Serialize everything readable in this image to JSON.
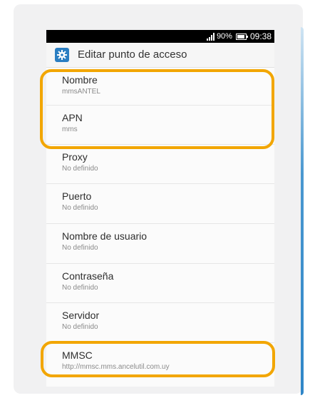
{
  "status_bar": {
    "battery_percent": "90%",
    "time": "09:38"
  },
  "header": {
    "title": "Editar punto de acceso",
    "icon": "settings-gear-icon"
  },
  "fields": [
    {
      "label": "Nombre",
      "value": "mmsANTEL"
    },
    {
      "label": "APN",
      "value": "mms"
    },
    {
      "label": "Proxy",
      "value": "No definido"
    },
    {
      "label": "Puerto",
      "value": "No definido"
    },
    {
      "label": "Nombre de usuario",
      "value": "No definido"
    },
    {
      "label": "Contraseña",
      "value": "No definido"
    },
    {
      "label": "Servidor",
      "value": "No definido"
    },
    {
      "label": "MMSC",
      "value": "http://mmsc.mms.ancelutil.com.uy"
    }
  ],
  "colors": {
    "highlight": "#f2a600",
    "accent": "#2a7ec2"
  }
}
